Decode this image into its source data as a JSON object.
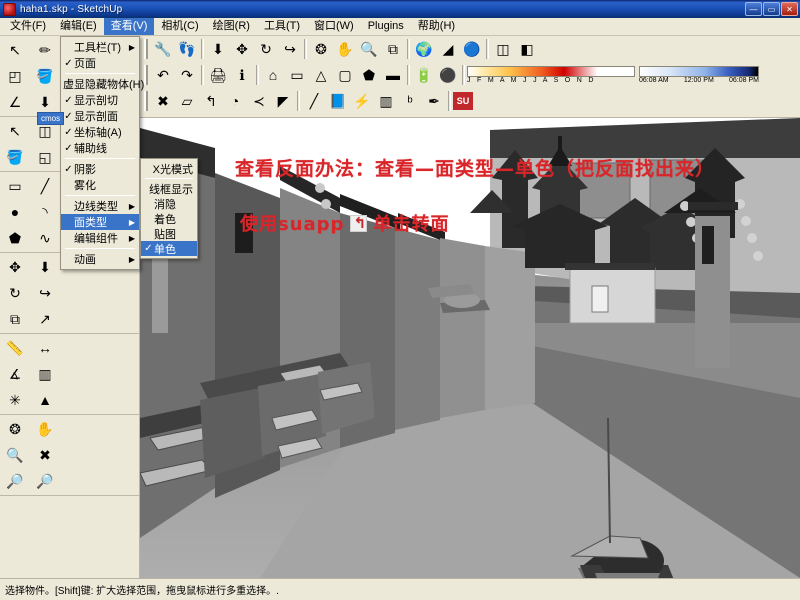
{
  "window": {
    "title": "haha1.skp - SketchUp",
    "icon": "sketchup-app-icon",
    "minimize": "—",
    "maximize": "▭",
    "close": "✕"
  },
  "menubar": [
    {
      "label": "文件(F)",
      "active": false
    },
    {
      "label": "编辑(E)",
      "active": false
    },
    {
      "label": "查看(V)",
      "active": true
    },
    {
      "label": "相机(C)",
      "active": false
    },
    {
      "label": "绘图(R)",
      "active": false
    },
    {
      "label": "工具(T)",
      "active": false
    },
    {
      "label": "窗口(W)",
      "active": false
    },
    {
      "label": "Plugins",
      "active": false
    },
    {
      "label": "帮助(H)",
      "active": false
    }
  ],
  "view_menu": {
    "items": [
      {
        "label": "工具栏(T)",
        "check": "",
        "arrow": "▶",
        "selected": false
      },
      {
        "label": "页面",
        "check": "✓",
        "arrow": "",
        "selected": false
      },
      {
        "sep": true
      },
      {
        "label": "虚显隐藏物体(H)",
        "check": "",
        "arrow": "",
        "selected": false
      },
      {
        "label": "显示剖切",
        "check": "✓",
        "arrow": "",
        "selected": false
      },
      {
        "label": "显示剖面",
        "check": "✓",
        "arrow": "",
        "selected": false
      },
      {
        "label": "坐标轴(A)",
        "check": "✓",
        "arrow": "",
        "selected": false
      },
      {
        "label": "辅助线",
        "check": "✓",
        "arrow": "",
        "selected": false
      },
      {
        "sep": true
      },
      {
        "label": "阴影",
        "check": "✓",
        "arrow": "",
        "selected": false
      },
      {
        "label": "雾化",
        "check": "",
        "arrow": "",
        "selected": false
      },
      {
        "sep": true
      },
      {
        "label": "边线类型",
        "check": "",
        "arrow": "▶",
        "selected": false
      },
      {
        "label": "面类型",
        "check": "",
        "arrow": "▶",
        "selected": true
      },
      {
        "label": "编辑组件",
        "check": "",
        "arrow": "▶",
        "selected": false
      },
      {
        "sep": true
      },
      {
        "label": "动画",
        "check": "",
        "arrow": "▶",
        "selected": false
      }
    ]
  },
  "face_style_submenu": {
    "items": [
      {
        "label": "X光模式",
        "check": "",
        "selected": false
      },
      {
        "sep": true
      },
      {
        "label": "线框显示",
        "check": "",
        "selected": false
      },
      {
        "label": "消隐",
        "check": "",
        "selected": false
      },
      {
        "label": "着色",
        "check": "",
        "selected": false
      },
      {
        "label": "贴图",
        "check": "",
        "selected": false
      },
      {
        "label": "单色",
        "check": "✓",
        "selected": true
      }
    ]
  },
  "tooltip_chip": {
    "text": "cmos"
  },
  "toolbars": {
    "row1": [
      {
        "icon": "orbit-icon",
        "glyph": "🔧"
      },
      {
        "icon": "walk-icon",
        "glyph": "👣"
      },
      {
        "sep": true
      },
      {
        "icon": "push-pull-icon",
        "glyph": "⬇"
      },
      {
        "icon": "move-icon",
        "glyph": "✥"
      },
      {
        "icon": "rotate-icon",
        "glyph": "↻"
      },
      {
        "icon": "follow-me-icon",
        "glyph": "↪"
      },
      {
        "sep": true
      },
      {
        "icon": "orbit-tool-icon",
        "glyph": "❂"
      },
      {
        "icon": "pan-icon",
        "glyph": "✋"
      },
      {
        "icon": "zoom-icon",
        "glyph": "🔍"
      },
      {
        "icon": "zoom-extents-icon",
        "glyph": "⧉"
      },
      {
        "sep": true
      },
      {
        "icon": "position-camera-icon",
        "glyph": "🌍"
      },
      {
        "icon": "look-around-icon",
        "glyph": "◢"
      },
      {
        "icon": "walkthrough-icon",
        "glyph": "🔵"
      },
      {
        "sep": true
      },
      {
        "icon": "section-plane-icon",
        "glyph": "◫"
      },
      {
        "icon": "display-section-icon",
        "glyph": "◧"
      }
    ],
    "row2": [
      {
        "icon": "undo-icon",
        "glyph": "↶"
      },
      {
        "icon": "redo-icon",
        "glyph": "↷"
      },
      {
        "sep": true
      },
      {
        "icon": "print-icon",
        "glyph": "🖨"
      },
      {
        "icon": "model-info-icon",
        "glyph": "ℹ"
      },
      {
        "sep": true
      },
      {
        "icon": "iso-view-icon",
        "glyph": "⌂"
      },
      {
        "icon": "front-view-icon",
        "glyph": "▭"
      },
      {
        "icon": "right-view-icon",
        "glyph": "△"
      },
      {
        "icon": "back-view-icon",
        "glyph": "▢"
      },
      {
        "icon": "left-view-icon",
        "glyph": "⬟"
      },
      {
        "icon": "top-view-icon",
        "glyph": "▬"
      },
      {
        "sep": true
      },
      {
        "icon": "shadow-settings-icon",
        "glyph": "🔋"
      },
      {
        "icon": "shadow-toggle-icon",
        "glyph": "⚫"
      }
    ],
    "row3": [
      {
        "icon": "axes-icon",
        "glyph": "✖"
      },
      {
        "icon": "face-icon",
        "glyph": "▱"
      },
      {
        "icon": "flip-face-icon",
        "glyph": "↰"
      },
      {
        "icon": "sandbox-icon",
        "glyph": "◔"
      },
      {
        "icon": "angle-icon",
        "glyph": "≺"
      },
      {
        "icon": "reverse-icon",
        "glyph": "◤"
      },
      {
        "sep": true
      },
      {
        "icon": "ruler-icon",
        "glyph": "╱"
      },
      {
        "icon": "book-icon",
        "glyph": "📘"
      },
      {
        "icon": "lightning-icon",
        "glyph": "⚡"
      },
      {
        "icon": "window-icon",
        "glyph": "▥"
      },
      {
        "icon": "group-icon",
        "glyph": "ᵇ"
      },
      {
        "icon": "pen-icon",
        "glyph": "✒"
      },
      {
        "sep": true
      },
      {
        "icon": "suapp-icon",
        "glyph": "SU"
      }
    ],
    "shadow_months": "J F M A M J J A S O N D",
    "shadow_times": [
      "06:08 AM",
      "12:00 PM",
      "06:08 PM"
    ]
  },
  "left_toolbar": {
    "blocks": [
      {
        "rows": [
          [
            "select-arrow-icon",
            "pencil-icon",
            "rectangle-icon"
          ],
          [
            "eraser-icon",
            "paint-bucket-icon",
            "save-icon"
          ],
          [
            "protractor-icon",
            "push-pull-icon",
            "text-icon"
          ]
        ]
      },
      {
        "rows": [
          [
            "select-tool-icon",
            "make-component-icon"
          ],
          [
            "paint-bucket-tool-icon",
            "eraser-tool-icon"
          ]
        ]
      },
      {
        "rows": [
          [
            "rectangle-tool-icon",
            "line-tool-icon"
          ],
          [
            "circle-tool-icon",
            "arc-tool-icon"
          ],
          [
            "polygon-tool-icon",
            "freehand-tool-icon"
          ]
        ]
      },
      {
        "rows": [
          [
            "move-tool-icon",
            "pushpull-tool-icon"
          ],
          [
            "rotate-tool-icon",
            "followme-tool-icon"
          ],
          [
            "scale-tool-icon",
            "offset-tool-icon"
          ]
        ]
      },
      {
        "rows": [
          [
            "tape-measure-icon",
            "dimension-icon"
          ],
          [
            "protractor-tool-icon",
            "text-tool-icon"
          ],
          [
            "axes-tool-icon",
            "3dtext-icon"
          ]
        ]
      },
      {
        "rows": [
          [
            "orbit-tool2-icon",
            "pan-tool-icon"
          ],
          [
            "zoom-tool-icon",
            "zoom-extents2-icon"
          ],
          [
            "previous-view-icon",
            "next-view-icon"
          ]
        ]
      }
    ]
  },
  "viewport": {
    "scene_name": "chinese-watertown-street-3d-scene",
    "background_sky": "#ffffff",
    "ground_color": "#a8a8a8",
    "annotation_line1": "查看反面办法：查看—面类型—单色（把反面找出来）",
    "annotation_line2_pre": "使用suapp",
    "annotation_line2_post": "单击转面",
    "annotation_color": "#d8262a"
  },
  "statusbar": {
    "text": "选择物件。[Shift]键: 扩大选择范围，拖曳鼠标进行多重选择。."
  }
}
